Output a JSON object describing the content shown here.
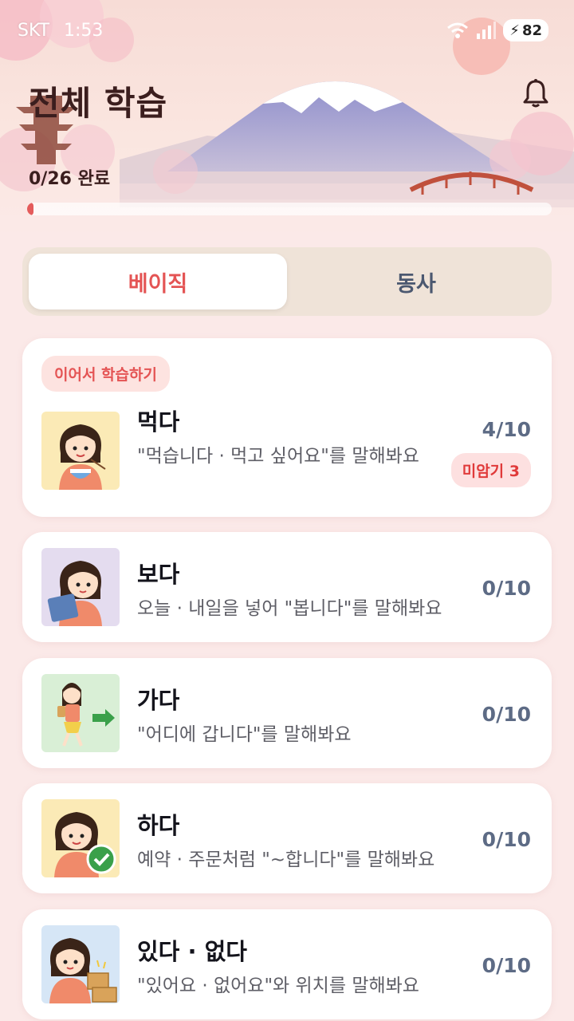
{
  "status_bar": {
    "carrier": "SKT",
    "time": "1:53",
    "battery": "82"
  },
  "header": {
    "title": "전체 학습",
    "progress_text": "0/26 완료",
    "progress_fraction": 0.012
  },
  "tabs": [
    {
      "label": "베이직",
      "active": true
    },
    {
      "label": "동사",
      "active": false
    }
  ],
  "resume_label": "이어서 학습하기",
  "lessons": [
    {
      "word": "먹다",
      "desc": "\"먹습니다 · 먹고 싶어요\"를 말해봐요",
      "score": "4/10",
      "unmemorized": "미암기 3"
    },
    {
      "word": "보다",
      "desc": "오늘 · 내일을 넣어 \"봅니다\"를 말해봐요",
      "score": "0/10"
    },
    {
      "word": "가다",
      "desc": "\"어디에 갑니다\"를 말해봐요",
      "score": "0/10"
    },
    {
      "word": "하다",
      "desc": "예약 · 주문처럼 \"~합니다\"를 말해봐요",
      "score": "0/10"
    },
    {
      "word": "있다 · 없다",
      "desc": "\"있어요 · 없어요\"와 위치를 말해봐요",
      "score": "0/10"
    }
  ],
  "colors": {
    "accent": "#e45454",
    "score": "#5d6b85",
    "title": "#3b1e1e"
  }
}
